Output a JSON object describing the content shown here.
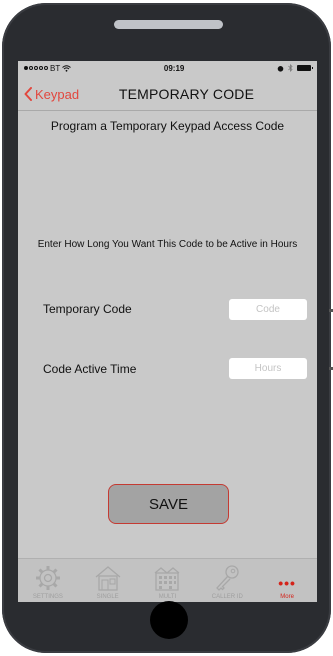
{
  "status_bar": {
    "carrier": "BT",
    "time": "09:19"
  },
  "nav": {
    "back_label": "Keypad",
    "title": "TEMPORARY CODE"
  },
  "main": {
    "subtitle": "Program a Temporary Keypad Access Code",
    "instruction": "Enter How Long You Want This Code to be Active in Hours",
    "fields": [
      {
        "label": "Temporary Code",
        "value": "",
        "placeholder": "Code"
      },
      {
        "label": "Code Active Time",
        "value": "",
        "placeholder": "Hours"
      }
    ],
    "save_label": "SAVE"
  },
  "tab_bar": {
    "items": [
      {
        "label": "SETTINGS",
        "icon": "gear-icon"
      },
      {
        "label": "SINGLE",
        "icon": "house-icon"
      },
      {
        "label": "MULTI",
        "icon": "building-icon"
      },
      {
        "label": "CALLER ID",
        "icon": "key-icon"
      },
      {
        "label": "More",
        "icon": "more-dots-icon",
        "active": true
      }
    ]
  },
  "colors": {
    "accent": "#e2473e",
    "screen_background": "#c9c9c9",
    "tab_active": "#d4231a",
    "tab_inactive": "#9f9f9f"
  }
}
